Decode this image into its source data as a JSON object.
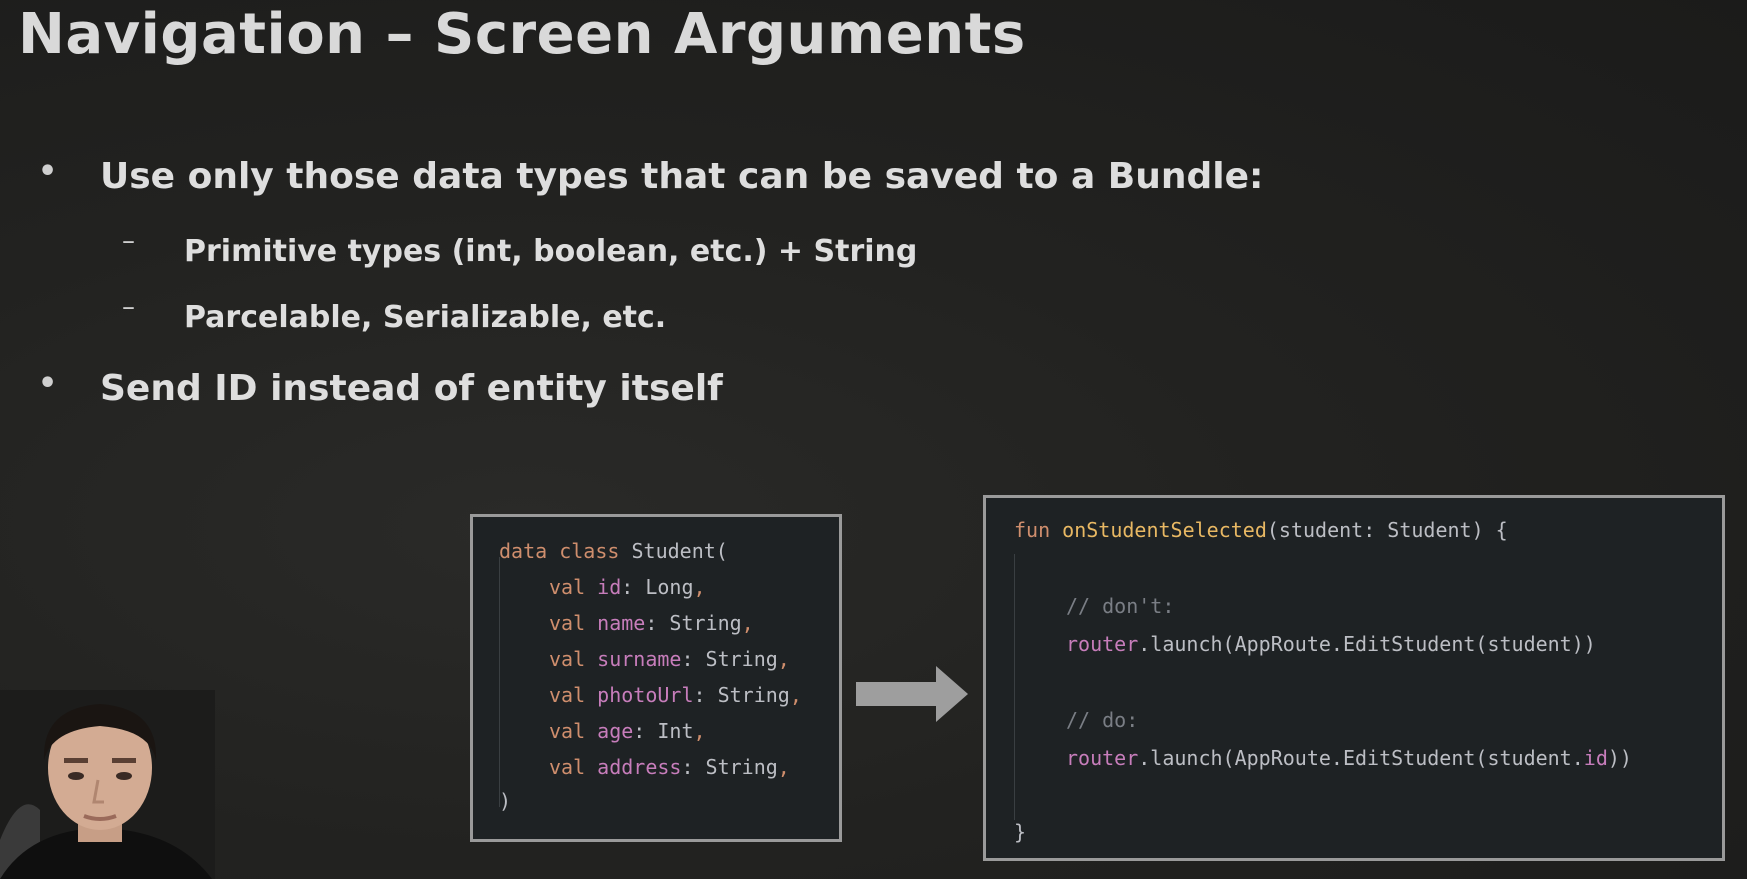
{
  "slide": {
    "title": "Navigation – Screen Arguments",
    "bullets": [
      {
        "marker": "•",
        "text": "Use only those data types that can be saved to a Bundle:",
        "sub": [
          {
            "marker": "–",
            "text": "Primitive types (int, boolean, etc.) + String"
          },
          {
            "marker": "–",
            "text": "Parcelable, Serializable, etc."
          }
        ]
      },
      {
        "marker": "•",
        "text": "Send ID instead of entity itself"
      }
    ]
  },
  "code_left": {
    "line1": {
      "kw1": "data",
      "kw2": "class",
      "name": "Student("
    },
    "fields": [
      {
        "kw": "val",
        "name": "id",
        "type": ": Long",
        "comma": ","
      },
      {
        "kw": "val",
        "name": "name",
        "type": ": String",
        "comma": ","
      },
      {
        "kw": "val",
        "name": "surname",
        "type": ": String",
        "comma": ","
      },
      {
        "kw": "val",
        "name": "photoUrl",
        "type": ": String",
        "comma": ","
      },
      {
        "kw": "val",
        "name": "age",
        "type": ": Int",
        "comma": ","
      },
      {
        "kw": "val",
        "name": "address",
        "type": ": String",
        "comma": ","
      }
    ],
    "close": ")"
  },
  "code_right": {
    "line1": {
      "kw": "fun",
      "fn": "onStudentSelected",
      "rest": "(student: Student) {"
    },
    "comment1": "// don't:",
    "call1": {
      "obj": "router",
      "rest": ".launch(AppRoute.EditStudent(student))"
    },
    "comment2": "// do:",
    "call2": {
      "obj": "router",
      "mid": ".launch(AppRoute.EditStudent(student.",
      "prop": "id",
      "end": "))"
    },
    "close": "}"
  },
  "colors": {
    "background": "#222220",
    "title": "#d9d9d9",
    "code_bg": "#1e2224",
    "keyword": "#cf8e6d",
    "property": "#c77dbb",
    "function": "#e8b863",
    "comment": "#7a7e85",
    "arrow": "#9e9e9e"
  },
  "icons": {
    "arrow": "right-arrow-icon",
    "presenter": "presenter-webcam"
  }
}
